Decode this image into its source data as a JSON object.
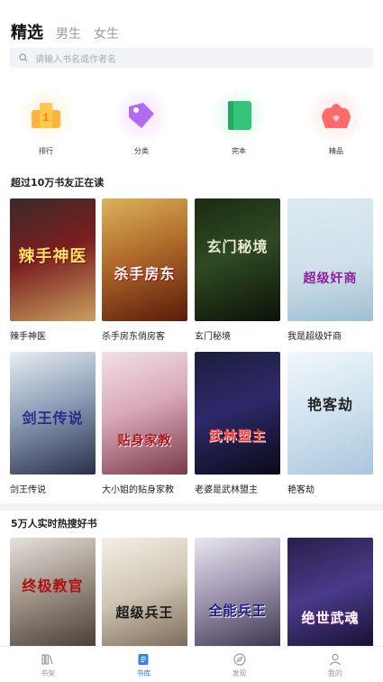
{
  "tabs": [
    {
      "label": "精选",
      "active": true
    },
    {
      "label": "男生",
      "active": false
    },
    {
      "label": "女生",
      "active": false
    }
  ],
  "search": {
    "placeholder": "请输入书名或作者名"
  },
  "categories": [
    {
      "label": "排行",
      "icon": "trophy-icon"
    },
    {
      "label": "分类",
      "icon": "tag-icon"
    },
    {
      "label": "完本",
      "icon": "book-icon"
    },
    {
      "label": "精品",
      "icon": "lotus-icon"
    }
  ],
  "section1": {
    "title": "超过10万书友正在读",
    "books": [
      {
        "name": "辣手神医",
        "cover_text": "辣手神医"
      },
      {
        "name": "杀手房东俏房客",
        "cover_text": "杀手房东"
      },
      {
        "name": "玄门秘境",
        "cover_text": "玄门秘境"
      },
      {
        "name": "我是超级奸商",
        "cover_text": "超级奸商"
      },
      {
        "name": "剑王传说",
        "cover_text": "剑王传说"
      },
      {
        "name": "大小姐的贴身家教",
        "cover_text": "贴身家教"
      },
      {
        "name": "老婆是武林盟主",
        "cover_text": "武林盟主"
      },
      {
        "name": "艳客劫",
        "cover_text": "艳客劫"
      }
    ]
  },
  "section2": {
    "title": "5万人实时热搜好书",
    "books": [
      {
        "cover_text": "终极教官"
      },
      {
        "cover_text": "超级兵王"
      },
      {
        "cover_text": "全能兵王"
      },
      {
        "cover_text": "绝世武魂"
      }
    ]
  },
  "nav": [
    {
      "label": "书架",
      "icon": "bookshelf-icon",
      "active": false
    },
    {
      "label": "书库",
      "icon": "library-icon",
      "active": true
    },
    {
      "label": "发现",
      "icon": "compass-icon",
      "active": false
    },
    {
      "label": "我的",
      "icon": "user-icon",
      "active": false
    }
  ],
  "colors": {
    "accent": "#2f7ff0",
    "muted": "#9a9a9a"
  }
}
